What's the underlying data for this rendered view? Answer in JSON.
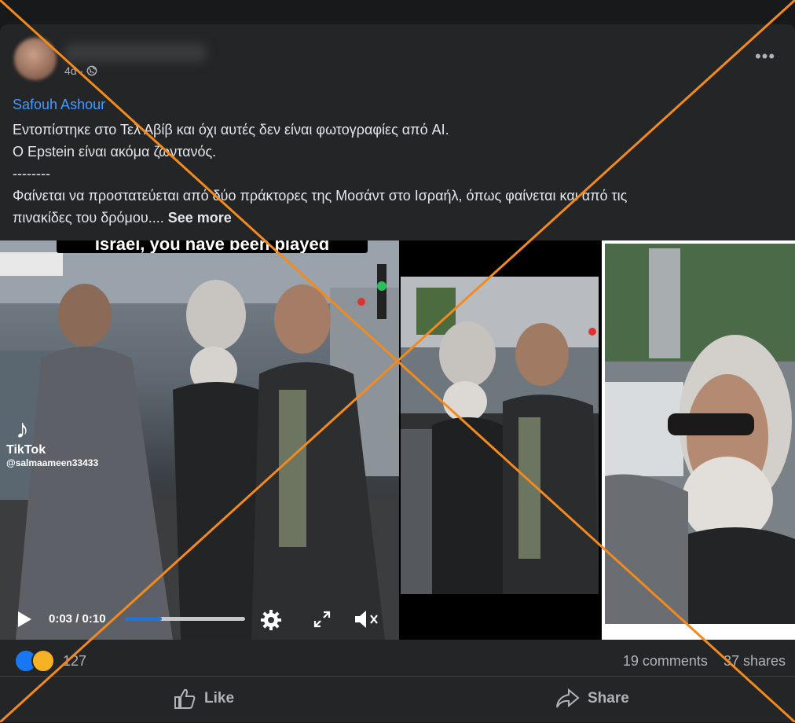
{
  "header": {
    "timestamp": "4d",
    "privacy_icon": "globe-icon",
    "more_icon": "more-options-icon"
  },
  "post": {
    "page_name": "Safouh Ashour",
    "lines": [
      "Εντοπίστηκε στο Τελ Αβίβ και όχι αυτές δεν είναι φωτογραφίες από AI.",
      "Ο Epstein είναι ακόμα ζωντανός.",
      "--------",
      "Φαίνεται να προστατεύεται από δύο πράκτορες της Μοσάντ στο Ισραήλ, όπως φαίνεται και από τις"
    ],
    "last_line": "πινακίδες του δρόμου.... ",
    "see_more": "See more"
  },
  "video": {
    "caption": "Israel, you have been played",
    "tiktok_label": "TikTok",
    "tiktok_user": "@salmaameen33433",
    "time": "0:03 / 0:10",
    "progress": 0.3
  },
  "stats": {
    "reaction_count": "127",
    "comments": "19 comments",
    "shares": "37 shares"
  },
  "actions": {
    "like": "Like",
    "share": "Share"
  },
  "colors": {
    "background": "#18191a",
    "card": "#242526",
    "link": "#4599ff",
    "cross": "#f28a1e"
  }
}
